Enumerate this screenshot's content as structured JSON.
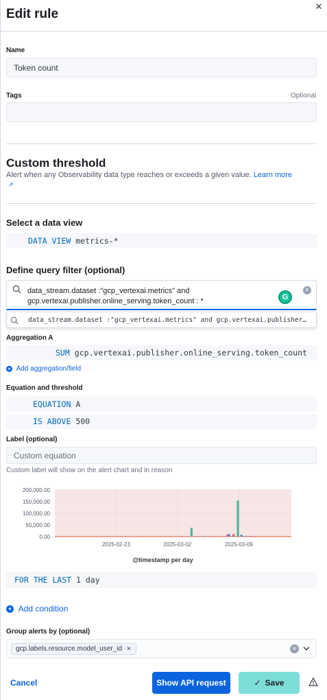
{
  "header": {
    "title": "Edit rule",
    "close_icon": "close-icon"
  },
  "name": {
    "label": "Name",
    "value": "Token count"
  },
  "tags": {
    "label": "Tags",
    "optional": "Optional",
    "value": ""
  },
  "threshold": {
    "heading": "Custom threshold",
    "description": "Alert when any Observability data type reaches or exceeds a given value.",
    "learn_more": "Learn more"
  },
  "data_view": {
    "heading": "Select a data view",
    "keyword": "DATA VIEW",
    "value": "metrics-*"
  },
  "query": {
    "heading": "Define query filter (optional)",
    "line1": "data_stream.dataset :\"gcp_vertexai.metrics\" and",
    "line2": "gcp.vertexai.publisher.online_serving.token_count : *",
    "suggestion": "data_stream.dataset :\"gcp_vertexai.metrics\" and gcp.vertexai.publisher…"
  },
  "aggregation": {
    "label": "Aggregation A",
    "keyword": "SUM",
    "field": "gcp.vertexai.publisher.online_serving.token_count",
    "add_label": "Add aggregation/field"
  },
  "equation": {
    "label": "Equation and threshold",
    "eq_keyword": "EQUATION",
    "eq_value": "A",
    "cond_keyword": "IS ABOVE",
    "cond_value": "500"
  },
  "custom_label": {
    "label": "Label (optional)",
    "placeholder": "Custom equation",
    "help": "Custom label will show on the alert chart and in reason"
  },
  "chart_data": {
    "type": "bar",
    "xlabel": "@timestamp per day",
    "ylim": [
      0,
      200000
    ],
    "yticks": [
      "200,000.00",
      "150,000.00",
      "100,000.00",
      "50,000.00",
      "0.00"
    ],
    "ytick_values": [
      200000,
      150000,
      100000,
      50000,
      0
    ],
    "xticks": [
      "2025-02-23",
      "2025-03-02",
      "2025-03-09"
    ],
    "xtick_days": [
      7,
      14,
      21
    ],
    "threshold": 500,
    "x_domain_days": [
      0,
      27
    ],
    "series": [
      {
        "color": "#54b399",
        "points": [
          [
            15.6,
            38000
          ],
          [
            16.6,
            2500
          ],
          [
            17.3,
            2000
          ],
          [
            20.3,
            1500
          ],
          [
            20.9,
            155000
          ],
          [
            21.9,
            3500
          ]
        ]
      },
      {
        "color": "#d36086",
        "points": [
          [
            16.0,
            1500
          ],
          [
            17.7,
            1500
          ],
          [
            19.7,
            9000
          ],
          [
            20.4,
            11000
          ],
          [
            22.4,
            2500
          ]
        ]
      },
      {
        "color": "#6092c0",
        "points": [
          [
            19.9,
            12000
          ],
          [
            21.3,
            9000
          ]
        ]
      }
    ],
    "colors": {
      "threshold_area": "#f8e6e6",
      "threshold_line": "#e7664c"
    }
  },
  "for_last": {
    "keyword": "FOR THE LAST",
    "value": "1 day"
  },
  "add_condition": {
    "label": "Add condition"
  },
  "group_by": {
    "label": "Group alerts by (optional)",
    "chip": "gcp.labels.resource.model_user_id"
  },
  "footer": {
    "cancel": "Cancel",
    "api": "Show API request",
    "save": "Save"
  },
  "colors": {
    "primary": "#0b64dd",
    "save_bg": "#7dded8",
    "keyword": "#006bb8"
  }
}
